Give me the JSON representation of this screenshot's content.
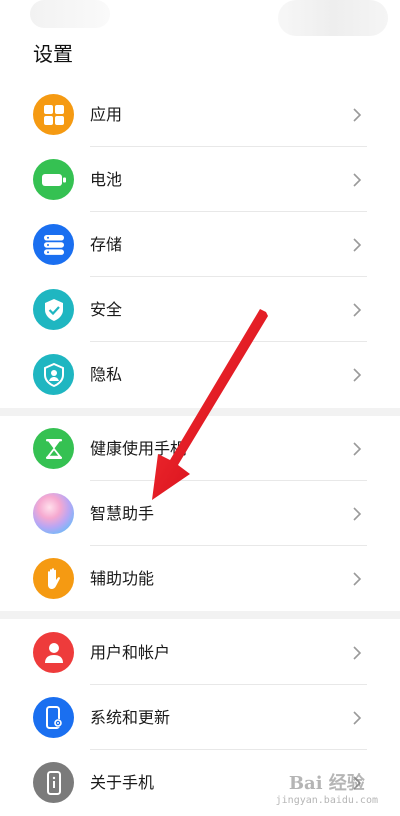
{
  "title": "设置",
  "colors": {
    "apps": "#f59a12",
    "battery": "#35c152",
    "storage": "#1a6ff0",
    "security": "#1fb6c1",
    "privacy": "#1fb6c1",
    "health": "#35c152",
    "assistant": "gradient",
    "accessibility": "#f59a12",
    "users": "#ee3b3b",
    "system": "#1a6ff0",
    "about": "#7b7b7b",
    "arrow": "#e8101a"
  },
  "groups": [
    {
      "items": [
        {
          "label": "应用",
          "icon": "apps-icon"
        },
        {
          "label": "电池",
          "icon": "battery-icon"
        },
        {
          "label": "存储",
          "icon": "storage-icon"
        },
        {
          "label": "安全",
          "icon": "security-shield-icon"
        },
        {
          "label": "隐私",
          "icon": "privacy-shield-icon"
        }
      ]
    },
    {
      "items": [
        {
          "label": "健康使用手机",
          "icon": "hourglass-icon"
        },
        {
          "label": "智慧助手",
          "icon": "assistant-orb-icon"
        },
        {
          "label": "辅助功能",
          "icon": "hand-icon"
        }
      ]
    },
    {
      "items": [
        {
          "label": "用户和帐户",
          "icon": "user-icon"
        },
        {
          "label": "系统和更新",
          "icon": "system-phone-icon"
        },
        {
          "label": "关于手机",
          "icon": "about-phone-icon"
        }
      ]
    }
  ],
  "watermark": {
    "main": "Bai 经验",
    "sub": "jingyan.baidu.com"
  }
}
